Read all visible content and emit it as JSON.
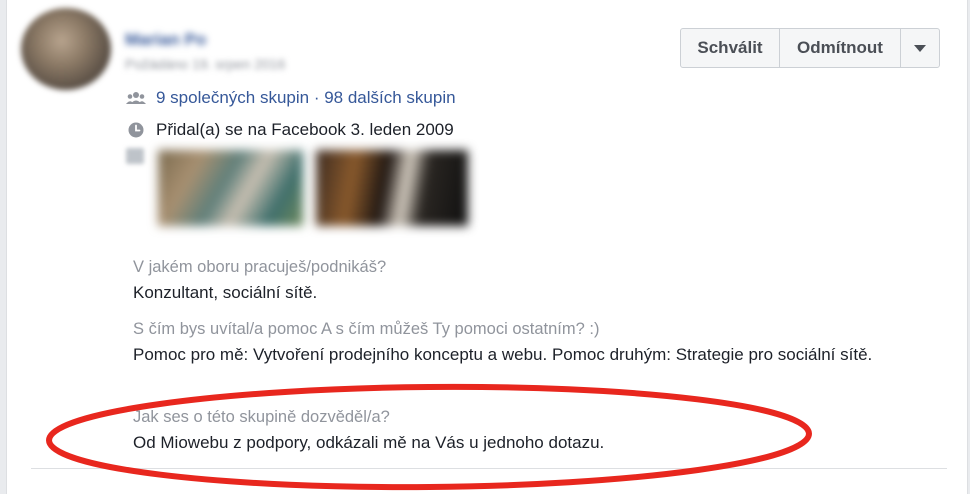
{
  "member": {
    "name": "Marian Po",
    "subline": "Požádáno 19. srpen 2016"
  },
  "actions": {
    "approve_label": "Schválit",
    "decline_label": "Odmítnout"
  },
  "info": {
    "groups_text": "9 společných skupin · 98 dalších skupin",
    "joined_text": "Přidal(a) se na Facebook 3. leden 2009"
  },
  "questions": [
    {
      "question": "V jakém oboru pracuješ/podnikáš?",
      "answer": "Konzultant, sociální sítě."
    },
    {
      "question": "S čím bys uvítal/a pomoc A s čím můžeš Ty pomoci ostatním? :)",
      "answer": "Pomoc pro mě: Vytvoření prodejního konceptu a webu. Pomoc druhým: Strategie pro sociální sítě."
    },
    {
      "question": "Jak ses o této skupině dozvěděl/a?",
      "answer": "Od Miowebu z podpory, odkázali mě na Vás u jednoho dotazu."
    }
  ],
  "colors": {
    "link": "#365899",
    "muted": "#90949c",
    "text": "#1d2129",
    "highlight": "#e8271e"
  },
  "icons": {
    "groups": "groups-icon",
    "clock": "clock-icon",
    "more": "chevron-down-icon"
  }
}
